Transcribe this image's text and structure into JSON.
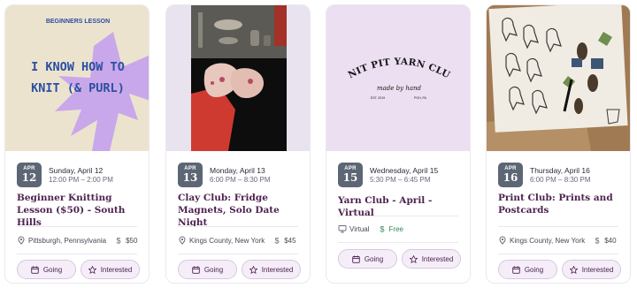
{
  "events": [
    {
      "image_text": [
        "BEGINNERS LESSON",
        "I KNOW HOW TO",
        "KNIT (& PURL)"
      ],
      "month": "APR",
      "day": "12",
      "date": "Sunday, April 12",
      "time": "12:00 PM – 2:00 PM",
      "title": "Beginner Knitting Lesson ($50) - South Hills",
      "location": "Pittsburgh, Pennsylvania",
      "location_icon": "map-pin-icon",
      "price": "$50"
    },
    {
      "month": "APR",
      "day": "13",
      "date": "Monday, April 13",
      "time": "6:00 PM – 8:30 PM",
      "title": "Clay Club: Fridge Magnets, Solo Date Night",
      "location": "Kings County, New York",
      "location_icon": "map-pin-icon",
      "price": "$45"
    },
    {
      "image_text": [
        "KNIT PIT YARN CLUB",
        "made by hand",
        "EST. 2019",
        "PGH, PA"
      ],
      "month": "APR",
      "day": "15",
      "date": "Wednesday, April 15",
      "time": "5:30 PM – 6:45 PM",
      "title": "Yarn Club - April - Virtual",
      "location": "Virtual",
      "location_icon": "monitor-icon",
      "price": "Free"
    },
    {
      "month": "APR",
      "day": "16",
      "date": "Thursday, April 16",
      "time": "6:00 PM – 8:30 PM",
      "title": "Print Club: Prints and Postcards",
      "location": "Kings County, New York",
      "location_icon": "map-pin-icon",
      "price": "$40"
    }
  ],
  "buttons": {
    "going": "Going",
    "interested": "Interested"
  },
  "colors": {
    "title": "#4e2350",
    "badge": "#5d6674",
    "button_bg": "#f5eef9",
    "free": "#2e8b57"
  }
}
